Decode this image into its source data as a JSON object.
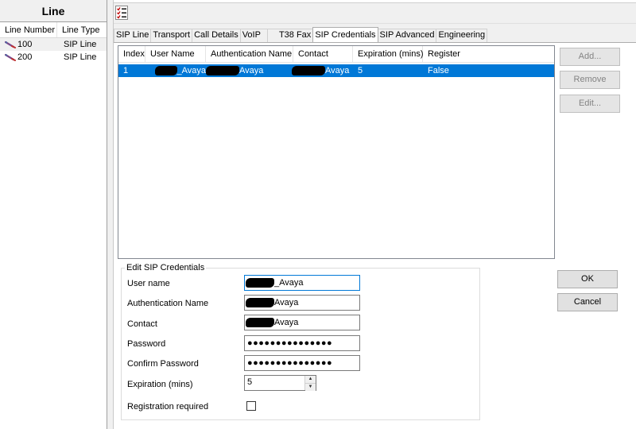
{
  "left_pane": {
    "title": "Line",
    "columns": [
      "Line Number",
      "Line Type"
    ],
    "rows": [
      {
        "number": "100",
        "type": "SIP Line",
        "selected": true
      },
      {
        "number": "200",
        "type": "SIP Line",
        "selected": false
      }
    ]
  },
  "tabs": [
    {
      "label": "SIP Line",
      "active": false
    },
    {
      "label": "Transport",
      "active": false
    },
    {
      "label": "Call Details",
      "active": false
    },
    {
      "label": "VoIP",
      "active": false
    },
    {
      "label": "T38 Fax",
      "active": false
    },
    {
      "label": "SIP Credentials",
      "active": true
    },
    {
      "label": "SIP Advanced",
      "active": false
    },
    {
      "label": "Engineering",
      "active": false
    }
  ],
  "credentials_table": {
    "columns": [
      "Index",
      "User Name",
      "Authentication Name",
      "Contact",
      "Expiration (mins)",
      "Register"
    ],
    "rows": [
      {
        "index": "1",
        "user_name": "_Avaya",
        "auth_name": "Avaya",
        "contact": "Avaya",
        "expiration": "5",
        "register": "False"
      }
    ]
  },
  "side_buttons": {
    "add": "Add...",
    "remove": "Remove",
    "edit": "Edit..."
  },
  "edit_group": {
    "legend": "Edit SIP Credentials",
    "user_name_label": "User name",
    "user_name_value": "_Avaya",
    "auth_name_label": "Authentication Name",
    "auth_name_value": "Avaya",
    "contact_label": "Contact",
    "contact_value": "Avaya",
    "password_label": "Password",
    "password_value": "●●●●●●●●●●●●●●●",
    "confirm_password_label": "Confirm Password",
    "confirm_password_value": "●●●●●●●●●●●●●●●",
    "expiration_label": "Expiration (mins)",
    "expiration_value": "5",
    "registration_label": "Registration required",
    "registration_checked": false
  },
  "dialog_buttons": {
    "ok": "OK",
    "cancel": "Cancel"
  },
  "colors": {
    "selection": "#0078d7",
    "focus_border": "#0078d7"
  },
  "icons": {
    "toolbar": "list-checklist-icon",
    "line": "line-cable-icon"
  }
}
